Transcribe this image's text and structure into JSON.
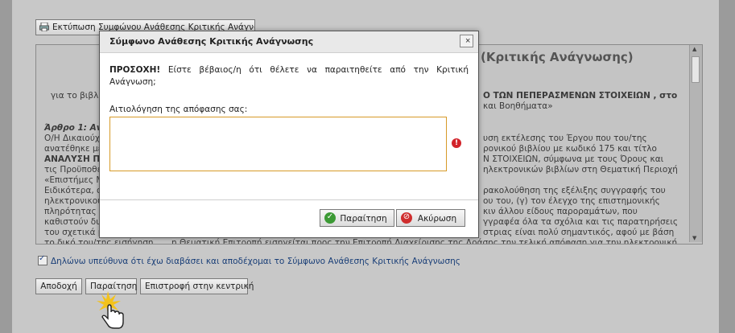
{
  "background": {
    "print_button_label": "Εκτύπωση Συμφώνου Ανάθεσης Κριτικής Ανάγνωσης",
    "document": {
      "title_fragment": "(Κριτικής Ανάγνωσης)",
      "lines": [
        "για το βιβλ",
        "Άρθρο 1: Αν",
        "Ο/Η Δικαιούχ",
        "ανατέθηκε με",
        "ΑΝΑΛΥΣΗ ΠΙ",
        "τις Προϋποθέ",
        "«Επιστήμες Μ",
        "Ειδικότερα, ο",
        "ηλεκτρονικού",
        "πληρότητας κ",
        "καθιστούν δυ",
        "του σχετικά μ",
        "το δικό του/της εισήγηση",
        "Ο ΤΩΝ ΠΕΠΕΡΑΣΜΕΝΩΝ ΣΤΟΙΧΕΙΩΝ , στο",
        "και Βοηθήματα»",
        "υση εκτέλεσης του Έργου που του/της",
        "ρονικού βιβλίου με κωδικό 175 και τίτλο",
        "Ν ΣΤΟΙΧΕΙΩΝ, σύμφωνα με τους Όρους και",
        "ηλεκτρονικών βιβλίων στη Θεματική Περιοχή",
        "ρακολούθηση της εξέλιξης συγγραφής του",
        "ου του, (γ) τον έλεγχο της επιστημονικής",
        "κιν άλλου είδους παροραμάτων, που",
        "γγραφέα όλα τα σχόλια και τις παρατηρήσεις",
        "στριας είναι πολύ σημαντικός, αφού με βάση",
        "η Θεματική Επιτροπή εισηγείται προς την Επιτροπή Διαχείρισης της Δράσης την τελική απόφαση για την ηλεκτρονική"
      ]
    },
    "agree_label": "Δηλώνω υπεύθυνα ότι έχω διαβάσει και αποδέχομαι το Σύμφωνο Ανάθεσης Κριτικής Ανάγνωσης",
    "agree_checked": true,
    "buttons": {
      "accept": "Αποδοχή",
      "resign": "Παραίτηση",
      "home": "Επιστροφή στην κεντρική"
    }
  },
  "dialog": {
    "title": "Σύμφωνο Ανάθεσης Κριτικής Ανάγνωσης",
    "close_symbol": "×",
    "warning_prefix": "ΠΡΟΣΟΧΗ!",
    "warning_text": " Είστε βέβαιος/η ότι θέλετε να παραιτηθείτε από την Κριτική Ανάγνωση;",
    "reason_label": "Αιτιολόγηση της απόφασης σας:",
    "reason_value": "",
    "error_symbol": "!",
    "resign_label": "Παραίτηση",
    "cancel_label": "Ακύρωση"
  },
  "colors": {
    "field_border": "#d79a28",
    "error": "#d2232a",
    "confirm": "#3c9a35",
    "cancel": "#cf2d2d"
  }
}
